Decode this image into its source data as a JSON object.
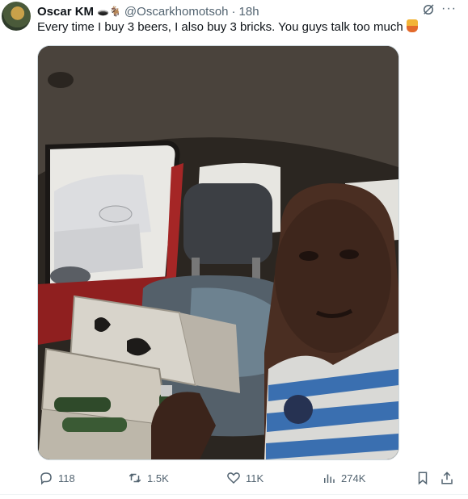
{
  "tweet": {
    "display_name": "Oscar KM",
    "name_badges": "🕳️🐐",
    "handle": "@Oscarkhomotsoh",
    "separator": "·",
    "time": "18h",
    "text": "Every time I buy 3 beers, I also buy 3 bricks. You guys talk too much",
    "text_emoji": "woman-emoji",
    "more_label": "···"
  },
  "media": {
    "description_icon": "photo"
  },
  "actions": {
    "replies": "118",
    "reposts": "1.5K",
    "likes": "11K",
    "views": "274K"
  },
  "colors": {
    "text": "#0f1419",
    "muted": "#536471",
    "border": "#cfd9de"
  }
}
